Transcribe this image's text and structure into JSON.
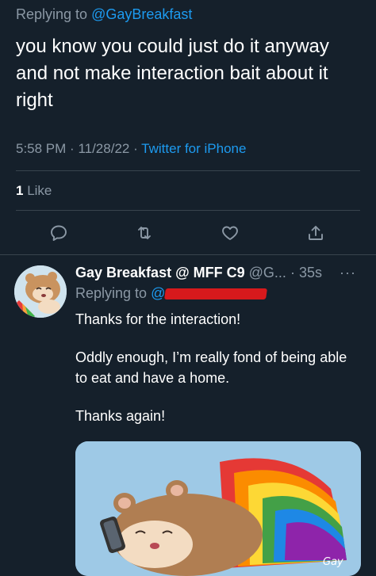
{
  "tweet": {
    "replying_prefix": "Replying to",
    "replying_handle": "@GayBreakfast",
    "text": "you know you could just do it anyway and not make interaction bait about it right",
    "time": "5:58 PM",
    "date": "11/28/22",
    "source": "Twitter for iPhone",
    "like_count": "1",
    "like_label": "Like"
  },
  "actions": [
    {
      "name": "reply-icon"
    },
    {
      "name": "retweet-icon"
    },
    {
      "name": "like-icon"
    },
    {
      "name": "share-icon"
    }
  ],
  "reply": {
    "display_name": "Gay Breakfast @ MFF C9",
    "handle": "@G...",
    "time": "35s",
    "replying_prefix": "Replying to",
    "replying_handle": "@",
    "para1": "Thanks for the interaction!",
    "para2": "Oddly enough, I’m really fond of being able to eat and have a home.",
    "para3": "Thanks again!",
    "image_signature": "Gay"
  },
  "colors": {
    "background": "#15202b",
    "accent": "#1d9bf0",
    "muted": "#8b98a5",
    "divider": "#38444d"
  }
}
